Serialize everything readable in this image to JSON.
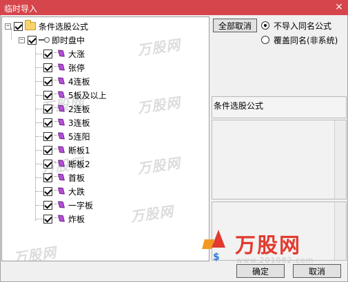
{
  "window": {
    "title": "临时导入",
    "close_glyph": "×"
  },
  "tree": {
    "root": {
      "label": "条件选股公式",
      "expander": "−",
      "checked": true,
      "icon": "folder-icon"
    },
    "group": {
      "label": "即时盘中",
      "expander": "−",
      "checked": true,
      "icon": "key-icon"
    },
    "items": [
      {
        "label": "大涨",
        "checked": true,
        "icon": "formula-diamond-icon"
      },
      {
        "label": "张停",
        "checked": true,
        "icon": "formula-diamond-icon"
      },
      {
        "label": "4连板",
        "checked": true,
        "icon": "formula-diamond-icon"
      },
      {
        "label": "5板及以上",
        "checked": true,
        "icon": "formula-diamond-icon"
      },
      {
        "label": "2连板",
        "checked": true,
        "icon": "formula-diamond-icon"
      },
      {
        "label": "3连板",
        "checked": true,
        "icon": "formula-diamond-icon"
      },
      {
        "label": "5连阳",
        "checked": true,
        "icon": "formula-diamond-icon"
      },
      {
        "label": "断板1",
        "checked": true,
        "icon": "formula-diamond-icon"
      },
      {
        "label": "断板2",
        "checked": true,
        "icon": "formula-diamond-icon"
      },
      {
        "label": "首板",
        "checked": true,
        "icon": "formula-diamond-icon"
      },
      {
        "label": "大跌",
        "checked": true,
        "icon": "formula-diamond-icon"
      },
      {
        "label": "一字板",
        "checked": true,
        "icon": "formula-diamond-icon"
      },
      {
        "label": "炸板",
        "checked": true,
        "icon": "formula-diamond-icon"
      }
    ],
    "watermark_text": "万股网"
  },
  "options": {
    "cancel_all_label": "全部取消",
    "radio_skip_label": "不导入同名公式",
    "radio_overwrite_label": "覆盖同名(非系统)",
    "selected": "skip"
  },
  "info": {
    "title": "条件选股公式"
  },
  "footer": {
    "confirm_label": "确定",
    "cancel_label": "取消"
  },
  "logo": {
    "brand": "万股网",
    "url": "www.201082.com"
  }
}
